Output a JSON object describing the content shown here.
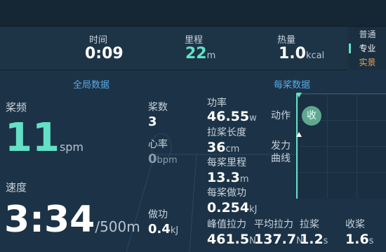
{
  "summary": {
    "time": {
      "label": "时间",
      "value": "0:09"
    },
    "distance": {
      "label": "里程",
      "value": "22",
      "unit": "m"
    },
    "calories": {
      "label": "热量",
      "value": "1.0",
      "unit": "kcal"
    }
  },
  "modes": {
    "items": [
      {
        "label": "普通",
        "color": "#c9d3dc"
      },
      {
        "label": "专业",
        "color": "#ffffff",
        "active": true
      },
      {
        "label": "实景",
        "color": "#f0a24a"
      }
    ]
  },
  "global": {
    "title": "全局数据",
    "stroke_rate": {
      "label": "桨频",
      "value": "11",
      "unit": "spm"
    },
    "speed": {
      "label": "速度",
      "value": "3:34",
      "unit": "/500m"
    },
    "stroke_count": {
      "label": "桨数",
      "value": "3"
    },
    "heart_rate": {
      "label": "心率",
      "value": "0",
      "unit": "bpm"
    },
    "work": {
      "label": "做功",
      "value": "0.4",
      "unit": "kJ"
    }
  },
  "per_stroke": {
    "title": "每桨数据",
    "power": {
      "label": "功率",
      "value": "46.55",
      "unit": "w"
    },
    "stroke_length": {
      "label": "拉桨长度",
      "value": "36",
      "unit": "cm"
    },
    "stroke_distance": {
      "label": "每桨里程",
      "value": "13.3",
      "unit": "m"
    },
    "stroke_work": {
      "label": "每桨做功",
      "value": "0.254",
      "unit": "kJ"
    },
    "peak_force": {
      "label": "峰值拉力",
      "value": "461.5",
      "unit": "N"
    },
    "avg_force": {
      "label": "平均拉力",
      "value": "137.7",
      "unit": "N"
    },
    "drive": {
      "label": "拉桨",
      "value": "1.2",
      "unit": "s"
    },
    "recovery": {
      "label": "收桨",
      "value": "1.6",
      "unit": "s"
    },
    "action": {
      "label": "动作",
      "state": "收"
    },
    "force_curve": {
      "label_line1": "发力",
      "label_line2": "曲线"
    }
  }
}
